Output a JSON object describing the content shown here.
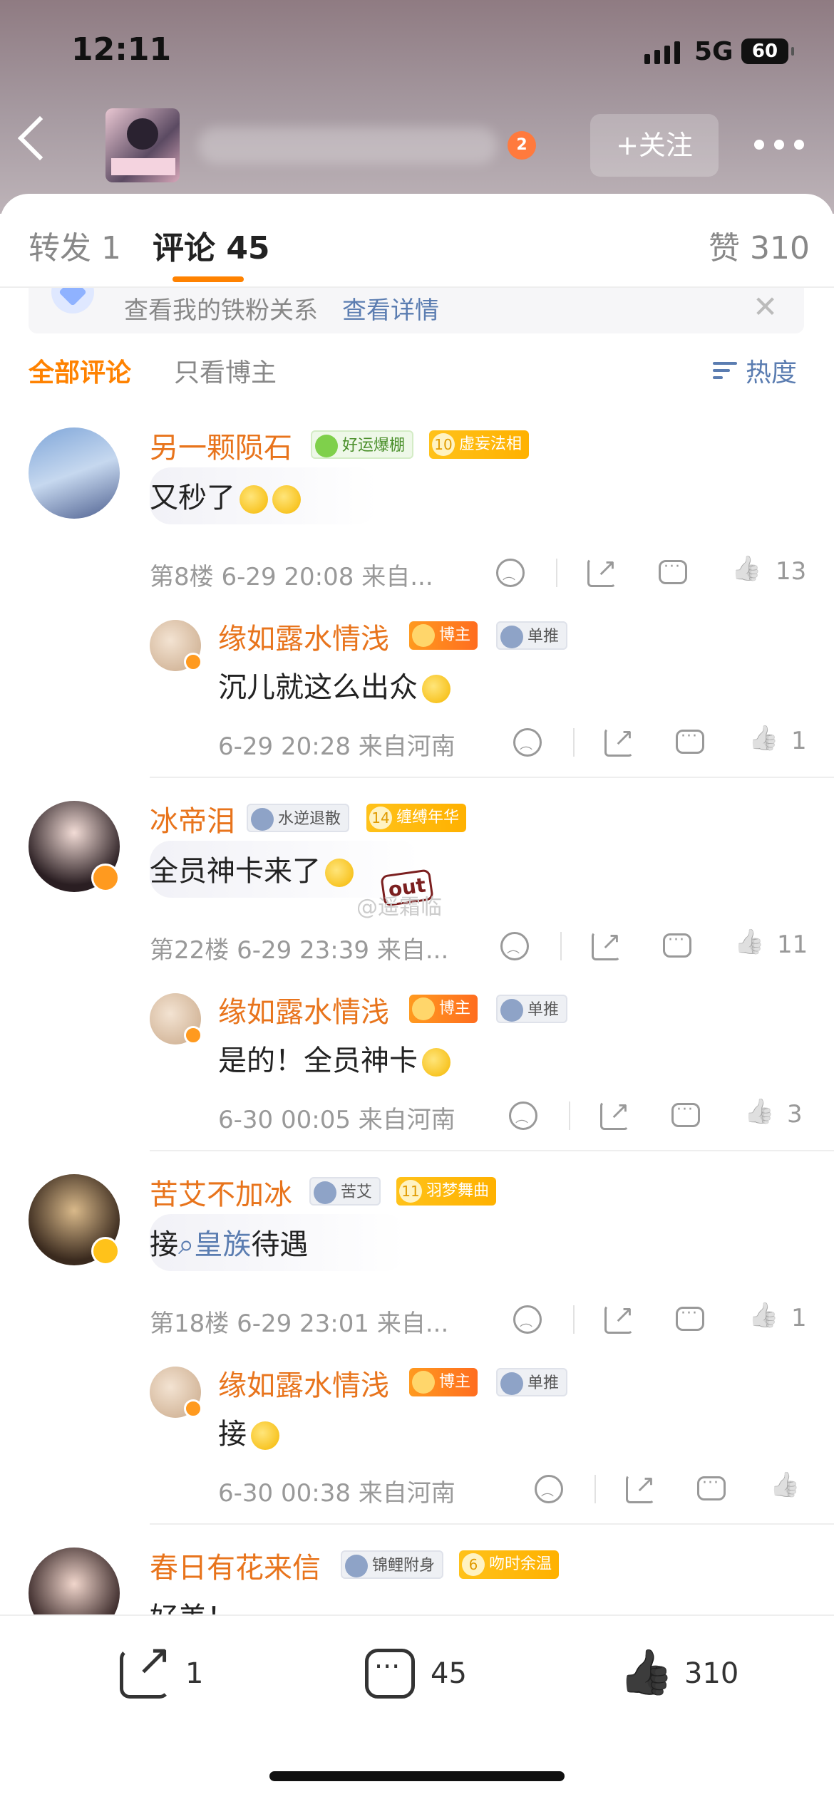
{
  "status_bar": {
    "time": "12:11",
    "network": "5G",
    "battery": "60"
  },
  "header": {
    "follow_label": "+关注",
    "vip_level": "2"
  },
  "tabs": [
    {
      "label": "转发 1"
    },
    {
      "label": "评论 45"
    },
    {
      "label": "赞 310"
    }
  ],
  "fan_banner": {
    "text": "查看我的铁粉关系",
    "link": "查看详情",
    "close": "✕"
  },
  "filters": {
    "all": "全部评论",
    "blogger_only": "只看博主",
    "sort": "热度"
  },
  "comments": [
    {
      "name": "另一颗陨石",
      "tag1": "好运爆棚",
      "tag2_level": "10",
      "tag2": "虚妄法相",
      "text": "又秒了",
      "meta": "第8楼 6-29 20:08 来自...",
      "likes": "13",
      "reply": {
        "name": "缘如露水情浅",
        "badge": "博主",
        "tag": "单推",
        "text": "沉儿就这么出众",
        "meta": "6-29 20:28 来自河南",
        "likes": "1"
      }
    },
    {
      "name": "冰帝泪",
      "tag1": "水逆退散",
      "tag2_level": "14",
      "tag2": "缠缚年华",
      "text": "全员神卡来了",
      "meta": "第22楼 6-29 23:39 来自...",
      "likes": "11",
      "reply": {
        "name": "缘如露水情浅",
        "badge": "博主",
        "tag": "单推",
        "text": "是的！全员神卡",
        "meta": "6-30 00:05 来自河南",
        "likes": "3"
      }
    },
    {
      "name": "苦艾不加冰",
      "tag1": "苦艾",
      "tag2_level": "11",
      "tag2": "羽梦舞曲",
      "text_prefix": "接",
      "text_link": "皇族",
      "text_suffix": "待遇",
      "meta": "第18楼 6-29 23:01 来自...",
      "likes": "1",
      "reply": {
        "name": "缘如露水情浅",
        "badge": "博主",
        "tag": "单推",
        "text": "接",
        "meta": "6-30 00:38 来自河南",
        "likes": ""
      }
    },
    {
      "name": "春日有花来信",
      "tag1": "锦鲤附身",
      "tag2_level": "6",
      "tag2": "吻时余温",
      "text": "好美！"
    }
  ],
  "watermark": "@遥霜临",
  "sticker_label": "out",
  "bottom_bar": {
    "reposts": "1",
    "comments": "45",
    "likes": "310"
  },
  "colors": {
    "accent": "#ff8200",
    "username": "#e8741c",
    "link": "#5b7db1"
  }
}
